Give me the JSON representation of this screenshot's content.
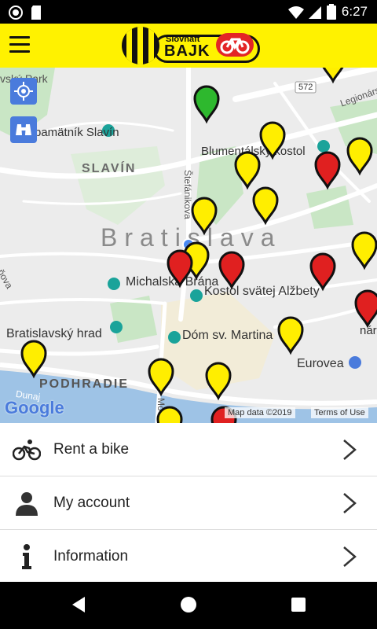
{
  "status": {
    "time": "6:27"
  },
  "app": {
    "brand_small": "Slovnaft",
    "brand_big": "BAJK"
  },
  "map": {
    "labels": {
      "slavin_area": "SLAVÍN",
      "city": "Bratislava",
      "michalska": "Michalská Brána",
      "kostol_alzbety": "Kostol svätej Alžbety",
      "hrad": "Bratislavský hrad",
      "dom": "Dóm sv. Martina",
      "podhradie": "PODHRADIE",
      "eurovea": "Eurovea",
      "blumental": "Blumentálsky kostol",
      "pamatnik": "pamätník Slavín",
      "stefanikova": "Štefánikova",
      "route": "572",
      "legionarska": "Legionárs",
      "dunaj": "Dunaj",
      "mo": "Mo",
      "nar": "nár",
      "hova": "ňova",
      "sky_park": "vský Park"
    },
    "google": "Google",
    "map_data": "Map data ©2019",
    "terms": "Terms of Use",
    "station_colors": {
      "available": "#ffee00",
      "empty": "#e02020",
      "selected": "#2eb82e"
    }
  },
  "menu": {
    "items": [
      {
        "label": "Rent a bike",
        "icon": "bike-icon"
      },
      {
        "label": "My account",
        "icon": "person-icon"
      },
      {
        "label": "Information",
        "icon": "info-icon"
      }
    ]
  }
}
